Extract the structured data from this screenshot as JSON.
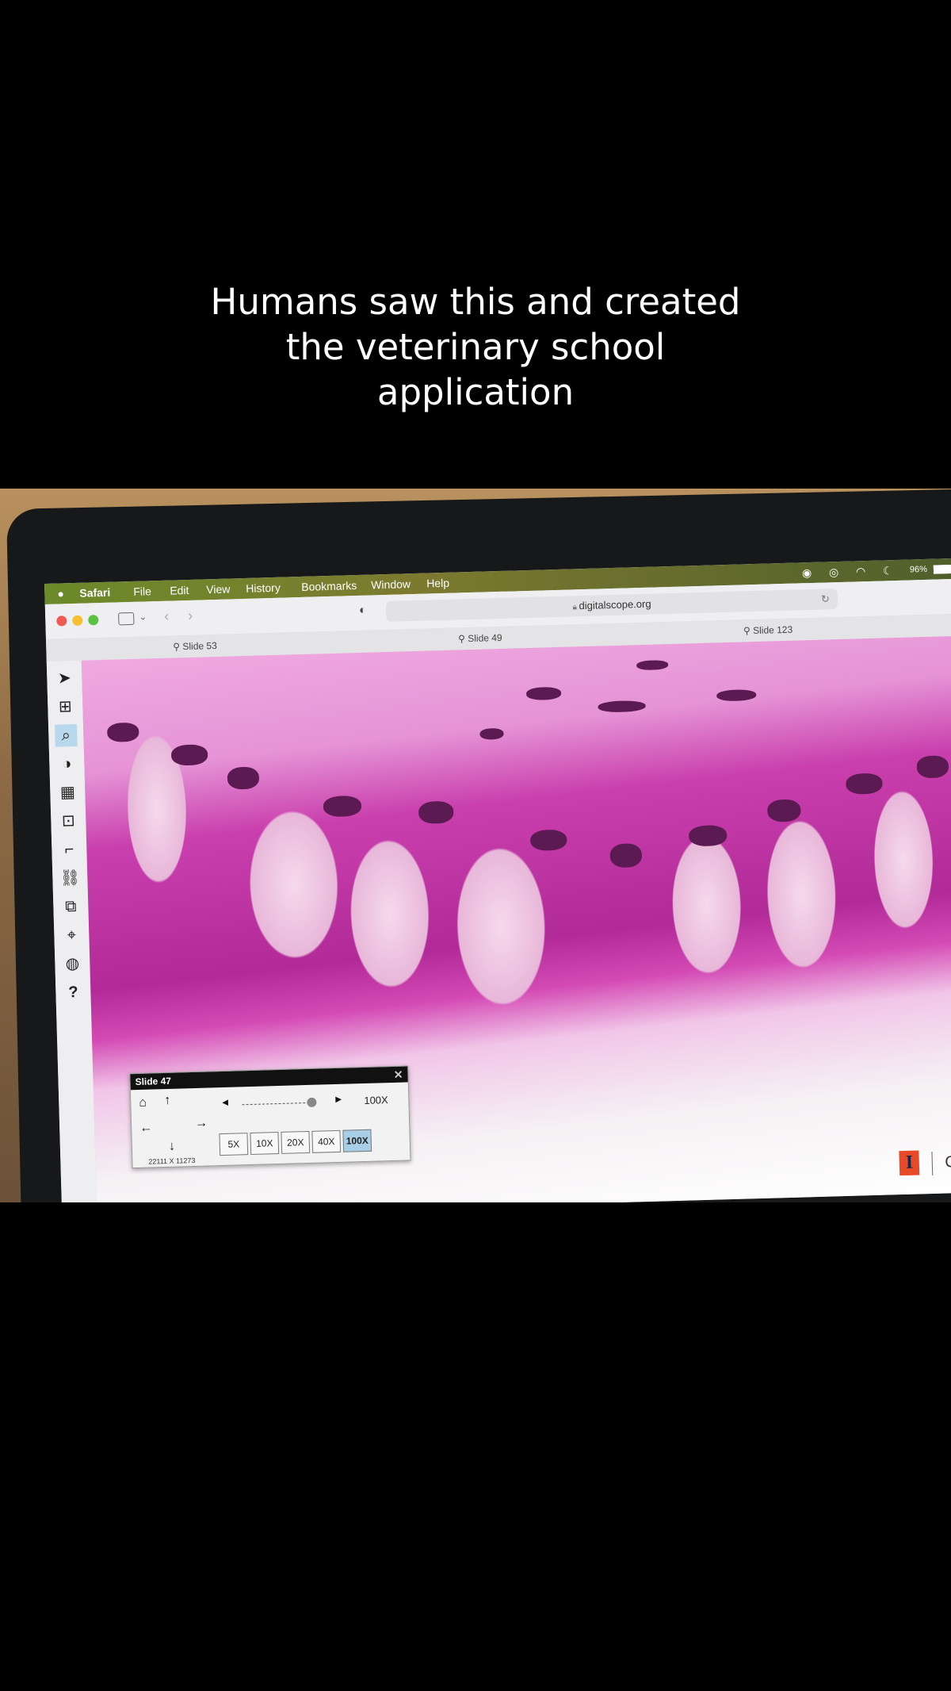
{
  "caption": {
    "line1": "Humans saw this and created",
    "line2": "the veterinary school",
    "line3": "application"
  },
  "menubar": {
    "apple": "",
    "app": "Safari",
    "items": [
      "File",
      "Edit",
      "View",
      "History",
      "Bookmarks",
      "Window",
      "Help"
    ],
    "battery": "96%"
  },
  "browser": {
    "url": "digitalscope.org"
  },
  "tabs": [
    "Slide 53",
    "Slide 49",
    "Slide 123"
  ],
  "toolbar_help": "?",
  "nav_panel": {
    "title": "Slide 47",
    "zoom_label": "100X",
    "magnifications": [
      "5X",
      "10X",
      "20X",
      "40X",
      "100X"
    ],
    "active_magnification": "100X",
    "dimensions": "22111 X 11273",
    "zoom_level": 0.95
  },
  "logo": {
    "mark": "I",
    "text": "Colle"
  },
  "colors": {
    "menubar": "#6b8a2a",
    "active_mag": "#a9cfe8",
    "tissue_stain": "#c93fad"
  }
}
